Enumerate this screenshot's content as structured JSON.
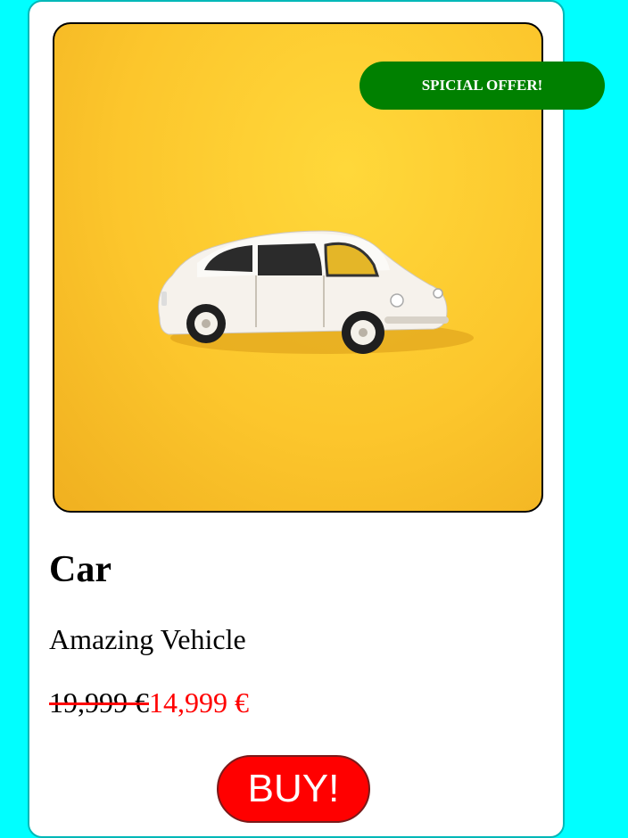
{
  "product": {
    "badge": "SPICIAL OFFER!",
    "title": "Car",
    "subtitle": "Amazing Vehicle",
    "old_price": "19,999 €",
    "new_price": "14,999 €",
    "buy_label": "BUY!"
  },
  "colors": {
    "page_background": "#00ffff",
    "badge_background": "#008000",
    "new_price": "#ff0000",
    "buy_button": "#ff0000",
    "photo_background": "#fcc62c"
  }
}
